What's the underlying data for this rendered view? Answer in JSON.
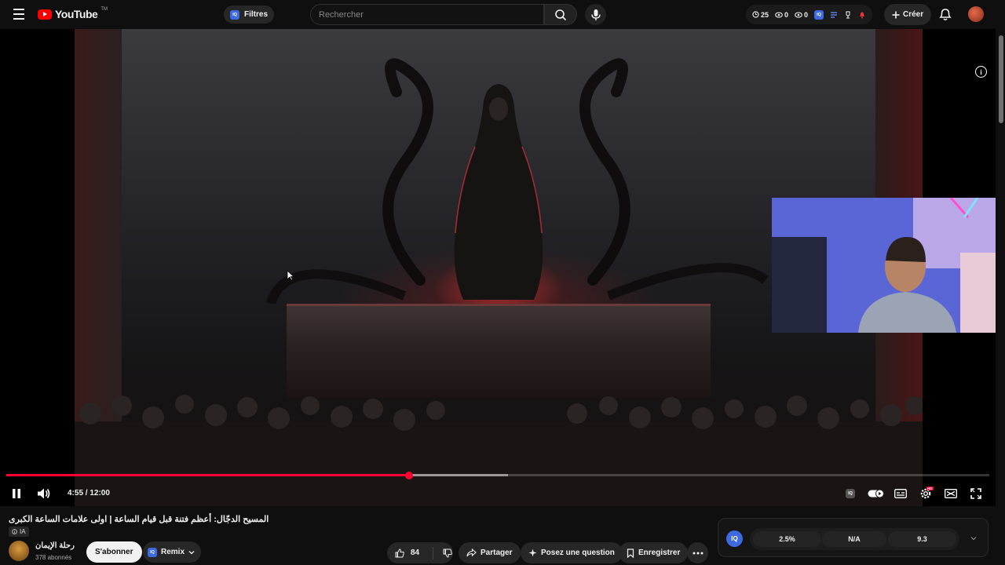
{
  "header": {
    "logo_text": "YouTube",
    "logo_tm": "TM",
    "filters_label": "Filtres",
    "filters_badge": "IQ",
    "search_placeholder": "Rechercher",
    "stats": [
      {
        "icon": "clock-icon",
        "value": "25"
      },
      {
        "icon": "eye-icon",
        "value": "0"
      },
      {
        "icon": "eye-icon",
        "value": "0"
      }
    ],
    "create_label": "Créer"
  },
  "player": {
    "current_time": "4:55",
    "duration": "12:00",
    "time_display": "4:55 / 12:00",
    "progress_fraction": 0.41,
    "buffered_fraction": 0.51,
    "settings_badge": "HD"
  },
  "video": {
    "title": "المسيح الدجّال: أعظم فتنة قبل قيام الساعة | اولى علامات الساعة الكبرى",
    "ai_label": "IA",
    "channel_name": "رحلة الإيمان",
    "subscribers": "378 abonnés",
    "subscribe_label": "S'abonner",
    "remix_label": "Remix",
    "remix_badge": "IQ",
    "like_count": "84",
    "share_label": "Partager",
    "ask_label": "Posez une question",
    "save_label": "Enregistrer"
  },
  "metrics": {
    "badge": "IQ",
    "values": [
      "2.5%",
      "N/A",
      "9.3"
    ]
  },
  "colors": {
    "accent": "#ff0033",
    "iq_blue": "#3e6ae1",
    "background": "#0f0f0f"
  }
}
